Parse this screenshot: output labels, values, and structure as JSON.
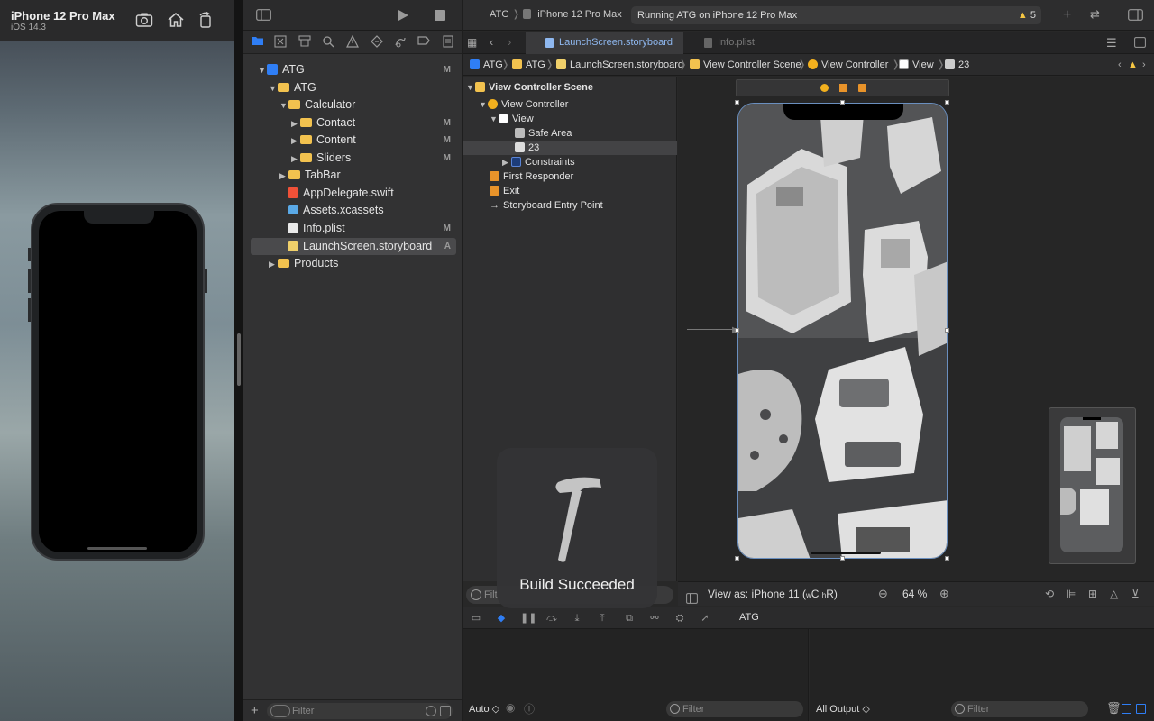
{
  "simulator": {
    "title": "iPhone 12 Pro Max",
    "os": "iOS 14.3",
    "buttons": [
      "screenshot-icon",
      "home-icon",
      "rotate-icon"
    ]
  },
  "toolbar": {
    "scheme": "ATG",
    "device": "iPhone 12 Pro Max",
    "status": "Running ATG on iPhone 12 Pro Max",
    "warning_count": "5"
  },
  "navigator": {
    "tree": [
      {
        "label": "ATG",
        "badge": "M",
        "level": 0,
        "icon": "project",
        "open": true
      },
      {
        "label": "ATG",
        "badge": "",
        "level": 1,
        "icon": "folder",
        "open": true
      },
      {
        "label": "Calculator",
        "badge": "",
        "level": 2,
        "icon": "folder",
        "open": true
      },
      {
        "label": "Contact",
        "badge": "M",
        "level": 3,
        "icon": "folder",
        "open": false
      },
      {
        "label": "Content",
        "badge": "M",
        "level": 3,
        "icon": "folder",
        "open": false
      },
      {
        "label": "Sliders",
        "badge": "M",
        "level": 3,
        "icon": "folder",
        "open": false
      },
      {
        "label": "TabBar",
        "badge": "",
        "level": 2,
        "icon": "folder",
        "open": false
      },
      {
        "label": "AppDelegate.swift",
        "badge": "",
        "level": 2,
        "icon": "swift"
      },
      {
        "label": "Assets.xcassets",
        "badge": "",
        "level": 2,
        "icon": "assets"
      },
      {
        "label": "Info.plist",
        "badge": "M",
        "level": 2,
        "icon": "file"
      },
      {
        "label": "LaunchScreen.storyboard",
        "badge": "A",
        "level": 2,
        "icon": "story",
        "selected": true
      },
      {
        "label": "Products",
        "badge": "",
        "level": 1,
        "icon": "folder",
        "open": false
      }
    ],
    "filter_placeholder": "Filter"
  },
  "tabs": [
    {
      "label": "LaunchScreen.storyboard",
      "active": true
    },
    {
      "label": "Info.plist",
      "active": false
    }
  ],
  "jumpbar": [
    "ATG",
    "ATG",
    "LaunchScreen.storyboard",
    "View Controller Scene",
    "View Controller",
    "View",
    "23"
  ],
  "outline": [
    {
      "label": "View Controller Scene",
      "level": 0,
      "bold": true
    },
    {
      "label": "View Controller",
      "level": 1
    },
    {
      "label": "View",
      "level": 2
    },
    {
      "label": "Safe Area",
      "level": 3
    },
    {
      "label": "23",
      "level": 3,
      "selected": true
    },
    {
      "label": "Constraints",
      "level": 3
    },
    {
      "label": "First Responder",
      "level": 1
    },
    {
      "label": "Exit",
      "level": 1
    },
    {
      "label": "Storyboard Entry Point",
      "level": 1
    }
  ],
  "canvas": {
    "outline_filter": "Filt",
    "view_as": "View as: iPhone 11 (",
    "size_w": "w",
    "size_c": "C",
    "size_h": "h",
    "size_r": "R)",
    "zoom": "64 %"
  },
  "debug": {
    "target": "ATG",
    "auto": "Auto ◇",
    "filter": "Filter",
    "output": "All Output ◇",
    "filter2": "Filter"
  },
  "hud": {
    "text": "Build Succeeded"
  }
}
